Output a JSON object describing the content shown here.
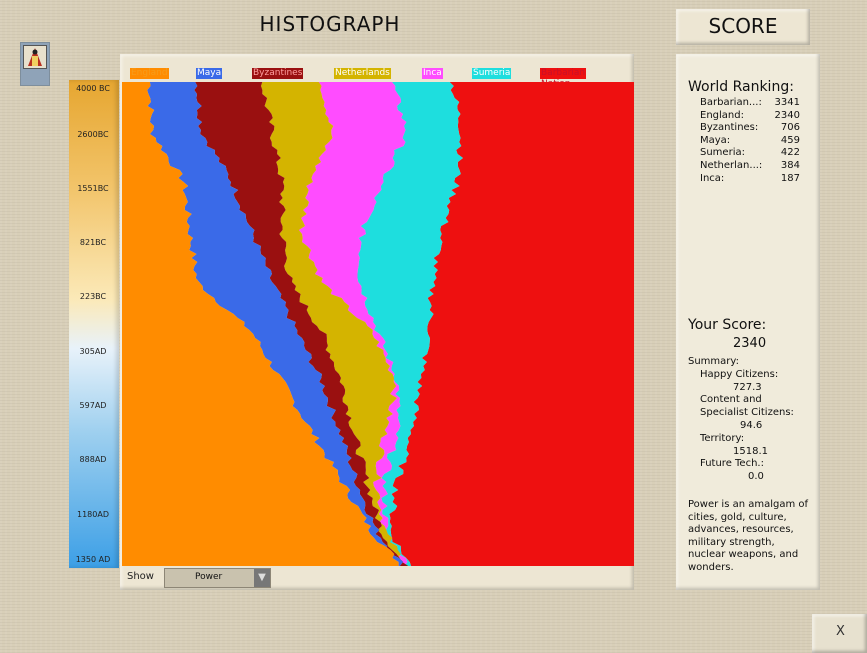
{
  "window": {
    "title": "HISTOGRAPH",
    "score_title": "SCORE",
    "close_label": "X"
  },
  "timeline": {
    "ticks": [
      "4000 BC",
      "2600BC",
      "1551BC",
      "821BC",
      "223BC",
      "305AD",
      "597AD",
      "888AD",
      "1180AD",
      "1350 AD"
    ]
  },
  "legend": [
    {
      "name": "England",
      "color": "#ff8c00",
      "text_color": "#f59c1a"
    },
    {
      "name": "Maya",
      "color": "#3a6ae8",
      "text_color": "#ffffff"
    },
    {
      "name": "Byzantines",
      "color": "#9a1010",
      "text_color": "#ff9fa0"
    },
    {
      "name": "Netherlands",
      "color": "#d4b400",
      "text_color": "#ffffff"
    },
    {
      "name": "Inca",
      "color": "#ff4cff",
      "text_color": "#ffffff"
    },
    {
      "name": "Sumeria",
      "color": "#1edede",
      "text_color": "#ffffff"
    },
    {
      "name": "Barbarian Nation",
      "color": "#ee1010",
      "text_color": "#c8102a"
    }
  ],
  "show": {
    "label": "Show",
    "selected": "Power"
  },
  "world_ranking": {
    "title": "World Ranking:",
    "rows": [
      {
        "name": "Barbarian...:",
        "value": "3341"
      },
      {
        "name": "England:",
        "value": "2340"
      },
      {
        "name": "Byzantines:",
        "value": "706"
      },
      {
        "name": "Maya:",
        "value": "459"
      },
      {
        "name": "Sumeria:",
        "value": "422"
      },
      {
        "name": "Netherlan...:",
        "value": "384"
      },
      {
        "name": "Inca:",
        "value": "187"
      }
    ]
  },
  "your_score": {
    "title": "Your Score:",
    "value": "2340",
    "summary_label": "Summary:",
    "happy_label": "Happy Citizens:",
    "happy_value": "727.3",
    "content_label1": "Content and",
    "content_label2": "Specialist Citizens:",
    "content_value": "94.6",
    "territory_label": "Territory:",
    "territory_value": "1518.1",
    "future_label": "Future Tech.:",
    "future_value": "0.0"
  },
  "power_note": "Power is an amalgam of cities, gold, culture, advances, resources, military strength, nuclear weapons, and wonders."
}
